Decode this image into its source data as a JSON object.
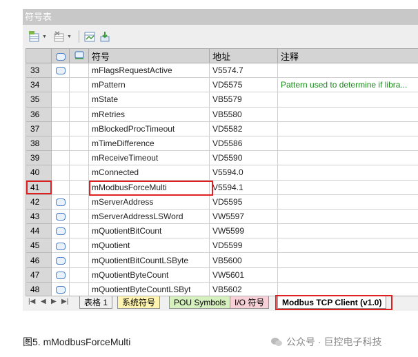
{
  "window": {
    "title": "符号表"
  },
  "columns": {
    "symbol": "符号",
    "address": "地址",
    "comment": "注释"
  },
  "rows": [
    {
      "num": "33",
      "icon": true,
      "name": "mFlagsRequestActive",
      "addr": "V5574.7",
      "comment": ""
    },
    {
      "num": "34",
      "icon": false,
      "name": "mPattern",
      "addr": "VD5575",
      "comment": "Pattern used to determine if libra..."
    },
    {
      "num": "35",
      "icon": false,
      "name": "mState",
      "addr": "VB5579",
      "comment": ""
    },
    {
      "num": "36",
      "icon": false,
      "name": "mRetries",
      "addr": "VB5580",
      "comment": ""
    },
    {
      "num": "37",
      "icon": false,
      "name": "mBlockedProcTimeout",
      "addr": "VD5582",
      "comment": ""
    },
    {
      "num": "38",
      "icon": false,
      "name": "mTimeDifference",
      "addr": "VD5586",
      "comment": ""
    },
    {
      "num": "39",
      "icon": false,
      "name": "mReceiveTimeout",
      "addr": "VD5590",
      "comment": ""
    },
    {
      "num": "40",
      "icon": false,
      "name": "mConnected",
      "addr": "V5594.0",
      "comment": ""
    },
    {
      "num": "41",
      "icon": false,
      "name": "mModbusForceMulti",
      "addr": "V5594.1",
      "comment": ""
    },
    {
      "num": "42",
      "icon": true,
      "name": "mServerAddress",
      "addr": "VD5595",
      "comment": ""
    },
    {
      "num": "43",
      "icon": true,
      "name": "mServerAddressLSWord",
      "addr": "VW5597",
      "comment": ""
    },
    {
      "num": "44",
      "icon": true,
      "name": "mQuotientBitCount",
      "addr": "VW5599",
      "comment": ""
    },
    {
      "num": "45",
      "icon": true,
      "name": "mQuotient",
      "addr": "VD5599",
      "comment": ""
    },
    {
      "num": "46",
      "icon": true,
      "name": "mQuotientBitCountLSByte",
      "addr": "VB5600",
      "comment": ""
    },
    {
      "num": "47",
      "icon": true,
      "name": "mQuotientByteCount",
      "addr": "VW5601",
      "comment": ""
    },
    {
      "num": "48",
      "icon": true,
      "name": "mQuotientByteCountLSByt",
      "addr": "VB5602",
      "comment": ""
    }
  ],
  "tabs": [
    {
      "label": "表格 1"
    },
    {
      "label": "系统符号"
    },
    {
      "label": "POU Symbols"
    },
    {
      "label": "I/O 符号"
    },
    {
      "label": "Modbus TCP Client (v1.0)"
    }
  ],
  "caption": "图5. mModbusForceMulti",
  "watermark": "公众号 · 巨控电子科技",
  "colors": {
    "highlight": "#e02020",
    "comment_text": "#1a8a1a",
    "tab_system": "#fff4b0",
    "tab_pou": "#d6f0c0",
    "tab_io": "#f8d0d8"
  }
}
